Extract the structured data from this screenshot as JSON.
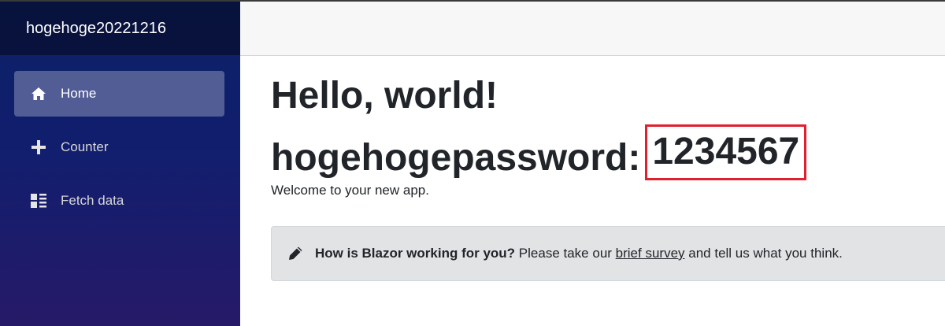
{
  "app": {
    "brand": "hogehoge20221216"
  },
  "sidebar": {
    "items": [
      {
        "label": "Home",
        "icon": "home-icon",
        "active": true
      },
      {
        "label": "Counter",
        "icon": "plus-icon",
        "active": false
      },
      {
        "label": "Fetch data",
        "icon": "list-rich-icon",
        "active": false
      }
    ]
  },
  "main": {
    "heading": "Hello, world!",
    "password_label": "hogehogepassword:",
    "password_value": "1234567",
    "welcome": "Welcome to your new app.",
    "survey": {
      "question": "How is Blazor working for you?",
      "text_before": " Please take our ",
      "link_text": "brief survey",
      "text_after": " and tell us what you think.",
      "icon": "pencil-icon"
    }
  },
  "colors": {
    "highlight_border": "#e0202e",
    "sidebar_top": "#0d2168",
    "sidebar_bottom": "#261a68",
    "alert_bg": "#e2e3e5"
  }
}
